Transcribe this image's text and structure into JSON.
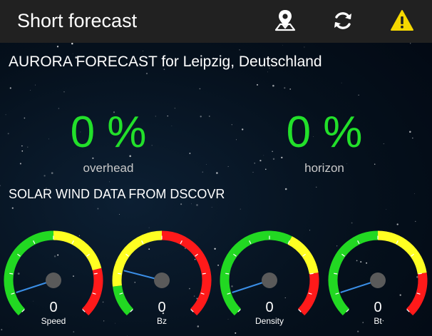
{
  "appbar": {
    "title": "Short forecast",
    "icons": [
      "map-pin-icon",
      "refresh-icon",
      "warning-icon"
    ]
  },
  "aurora": {
    "heading": "AURORA FORECAST for Leipzig, Deutschland",
    "overhead": {
      "value": "0 %",
      "label": "overhead"
    },
    "horizon": {
      "value": "0 %",
      "label": "horizon"
    }
  },
  "solar_wind": {
    "heading": "SOLAR WIND DATA FROM DSCOVR",
    "gauges": [
      {
        "name": "speed",
        "value": "0",
        "label": "Speed",
        "needle": 0.1,
        "segments": [
          [
            "#22d822",
            0,
            0.5
          ],
          [
            "#ffff22",
            0.5,
            0.78
          ],
          [
            "#ff1a1a",
            0.78,
            1
          ]
        ]
      },
      {
        "name": "bz",
        "value": "0",
        "label": "Bz",
        "needle": 0.22,
        "segments": [
          [
            "#22d822",
            0,
            0.14
          ],
          [
            "#ffff22",
            0.14,
            0.5
          ],
          [
            "#ff1a1a",
            0.5,
            1
          ]
        ]
      },
      {
        "name": "density",
        "value": "0",
        "label": "Density",
        "needle": 0.1,
        "segments": [
          [
            "#22d822",
            0,
            0.6
          ],
          [
            "#ffff22",
            0.6,
            0.8
          ],
          [
            "#ff1a1a",
            0.8,
            1
          ]
        ]
      },
      {
        "name": "bt",
        "value": "0",
        "label": "Bt",
        "needle": 0.1,
        "segments": [
          [
            "#22d822",
            0,
            0.5
          ],
          [
            "#ffff22",
            0.5,
            0.8
          ],
          [
            "#ff1a1a",
            0.8,
            1
          ]
        ]
      }
    ]
  },
  "colors": {
    "accent_green": "#22e02a",
    "appbar_bg": "#212121",
    "warning_yellow": "#f5d800",
    "needle_blue": "#3a8ee6"
  }
}
